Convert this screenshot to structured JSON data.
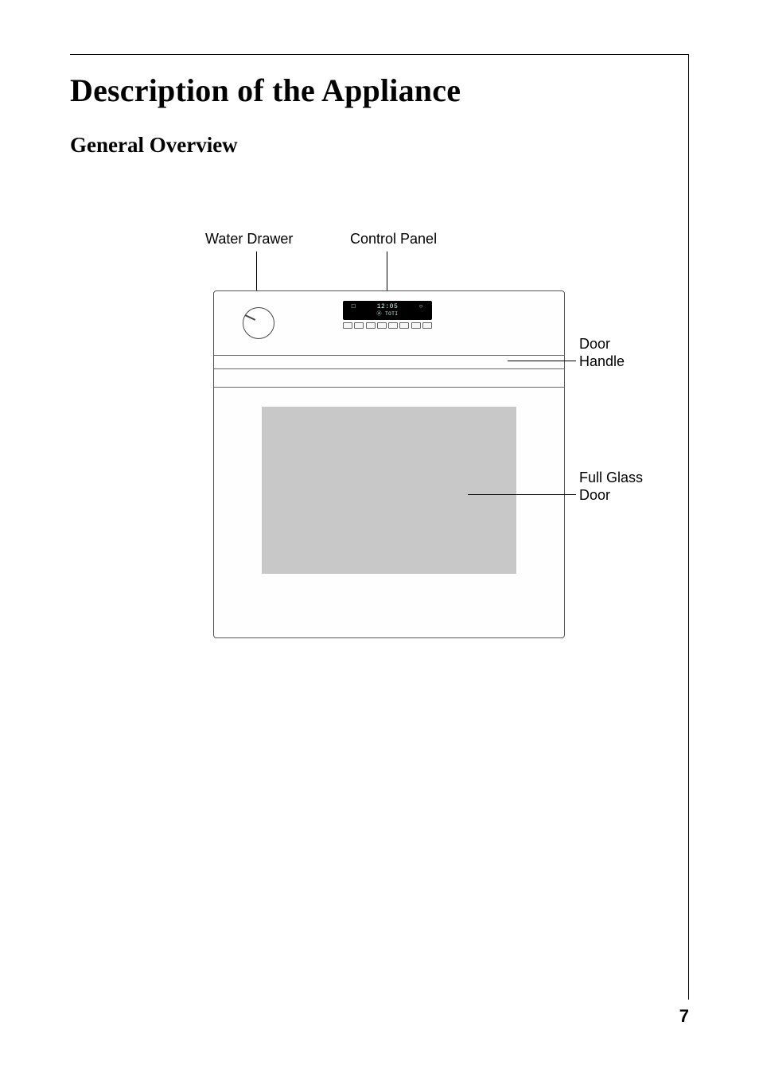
{
  "page": {
    "number": "7",
    "title": "Description of the Appliance",
    "subtitle": "General Overview"
  },
  "labels": {
    "water_drawer": "Water Drawer",
    "control_panel": "Control Panel",
    "door_handle": "Door Handle",
    "full_glass_door": "Full Glass Door"
  },
  "control_panel": {
    "display_time": "12:05",
    "display_icons_left": "□",
    "display_icons_right": "○",
    "display_sub": "Ⓐ   TOTI",
    "button_glyphs": [
      "□",
      "□",
      "?",
      "✓",
      "□",
      "□",
      "−",
      "+"
    ]
  }
}
